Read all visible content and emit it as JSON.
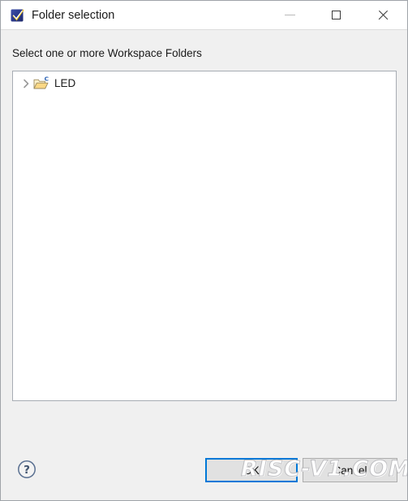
{
  "window": {
    "title": "Folder selection",
    "app_icon": "mounriver-check-icon",
    "controls": {
      "minimize_label": "Minimize",
      "maximize_label": "Maximize",
      "close_label": "Close"
    }
  },
  "dialog": {
    "prompt": "Select one or more Workspace Folders"
  },
  "tree": {
    "items": [
      {
        "label": "LED",
        "icon": "c-project-folder-icon",
        "expander": "chevron-right-icon",
        "expanded": false,
        "selected": false
      }
    ]
  },
  "footer": {
    "help_label": "?",
    "ok_label": "OK",
    "cancel_label": "Cancel"
  },
  "watermark": {
    "text": "RISC-V1.COM"
  },
  "colors": {
    "dialog_background": "#f0f0f0",
    "titlebar_background": "#ffffff",
    "tree_background": "#ffffff",
    "tree_border": "#a7acb3",
    "button_face": "#e1e1e1",
    "button_border": "#adadad",
    "focus_accent": "#0078d7",
    "text": "#1a1a1a"
  }
}
